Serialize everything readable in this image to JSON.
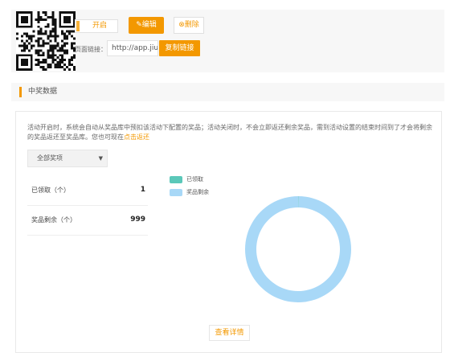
{
  "activity": {
    "status_toggle_label": "开启",
    "edit_label": "编辑",
    "delete_label": "删除",
    "page_link_label": "页面链接：",
    "page_link_value": "http://app.jiu",
    "copy_link_label": "复制链接"
  },
  "section": {
    "title": "中奖数据"
  },
  "notice": {
    "text": "活动开启时，系统会自动从奖品库中预扣该活动下配置的奖品；活动关闭时，不会立即返还剩余奖品，需到活动设置的结束时间到了才会将剩余的奖品返还至奖品库。您也可现在",
    "link": "点击返还"
  },
  "filter": {
    "selected": "全部奖项"
  },
  "stats": {
    "claimed_label": "已领取（个）",
    "claimed_value": "1",
    "remaining_label": "奖品剩余（个）",
    "remaining_value": "999"
  },
  "chart_data": {
    "type": "pie",
    "categories": [
      "已领取",
      "奖品剩余"
    ],
    "values": [
      1,
      999
    ],
    "colors": [
      "#5bc8b9",
      "#a8d8f7"
    ],
    "legend_position": "top-left"
  },
  "colors": {
    "accent": "#f39800",
    "claimed": "#5bc8b9",
    "remaining": "#a8d8f7"
  },
  "footer": {
    "detail_button": "查看详情"
  }
}
